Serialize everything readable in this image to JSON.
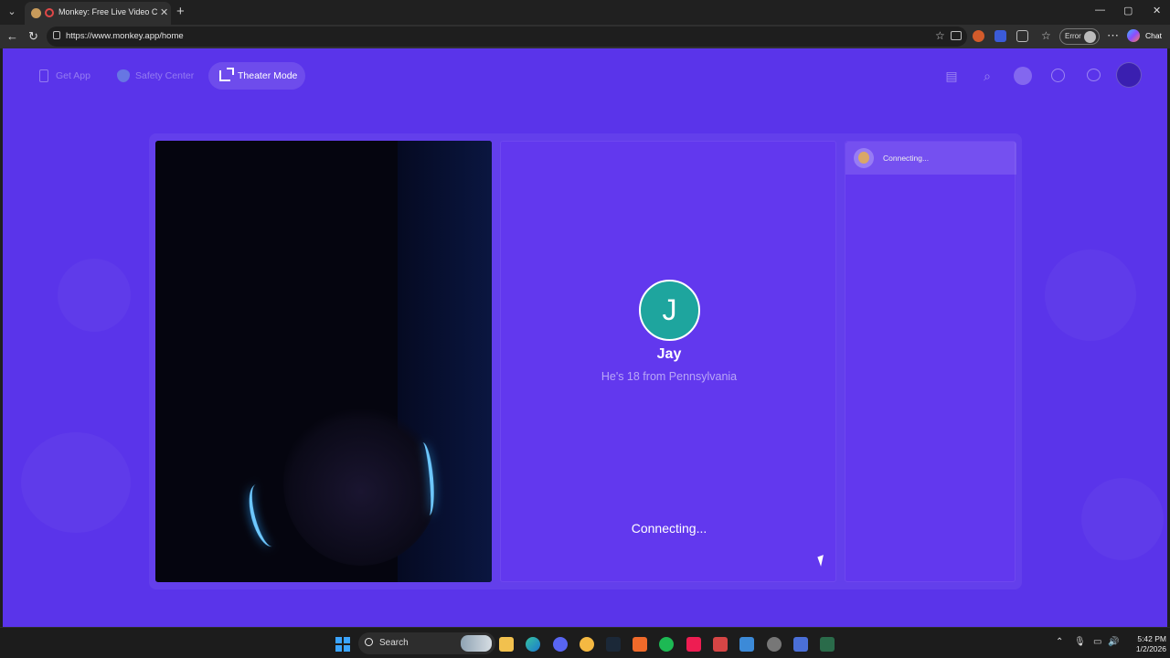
{
  "browser": {
    "tab_title": "Monkey: Free Live Video Chat",
    "tab_close": "✕",
    "new_tab": "+",
    "url": "https://www.monkey.app/home",
    "profile_label": "Error",
    "chat_label": "Chat",
    "window_controls": [
      "—",
      "▢",
      "✕"
    ]
  },
  "site": {
    "nav": {
      "get_app": "Get App",
      "safety_center": "Safety Center",
      "theater_mode": "Theater Mode"
    },
    "partner": {
      "initial": "J",
      "name": "Jay",
      "info": "He's 18 from Pennsylvania",
      "status": "Connecting..."
    },
    "chat": {
      "status": "Connecting..."
    }
  },
  "taskbar": {
    "search_label": "Search",
    "time": "5:42 PM",
    "date": "1/2/2026"
  },
  "colors": {
    "page_bg": "#5a34ea",
    "panel_bg": "#6238ee",
    "avatar_bg": "#1ea59e"
  }
}
